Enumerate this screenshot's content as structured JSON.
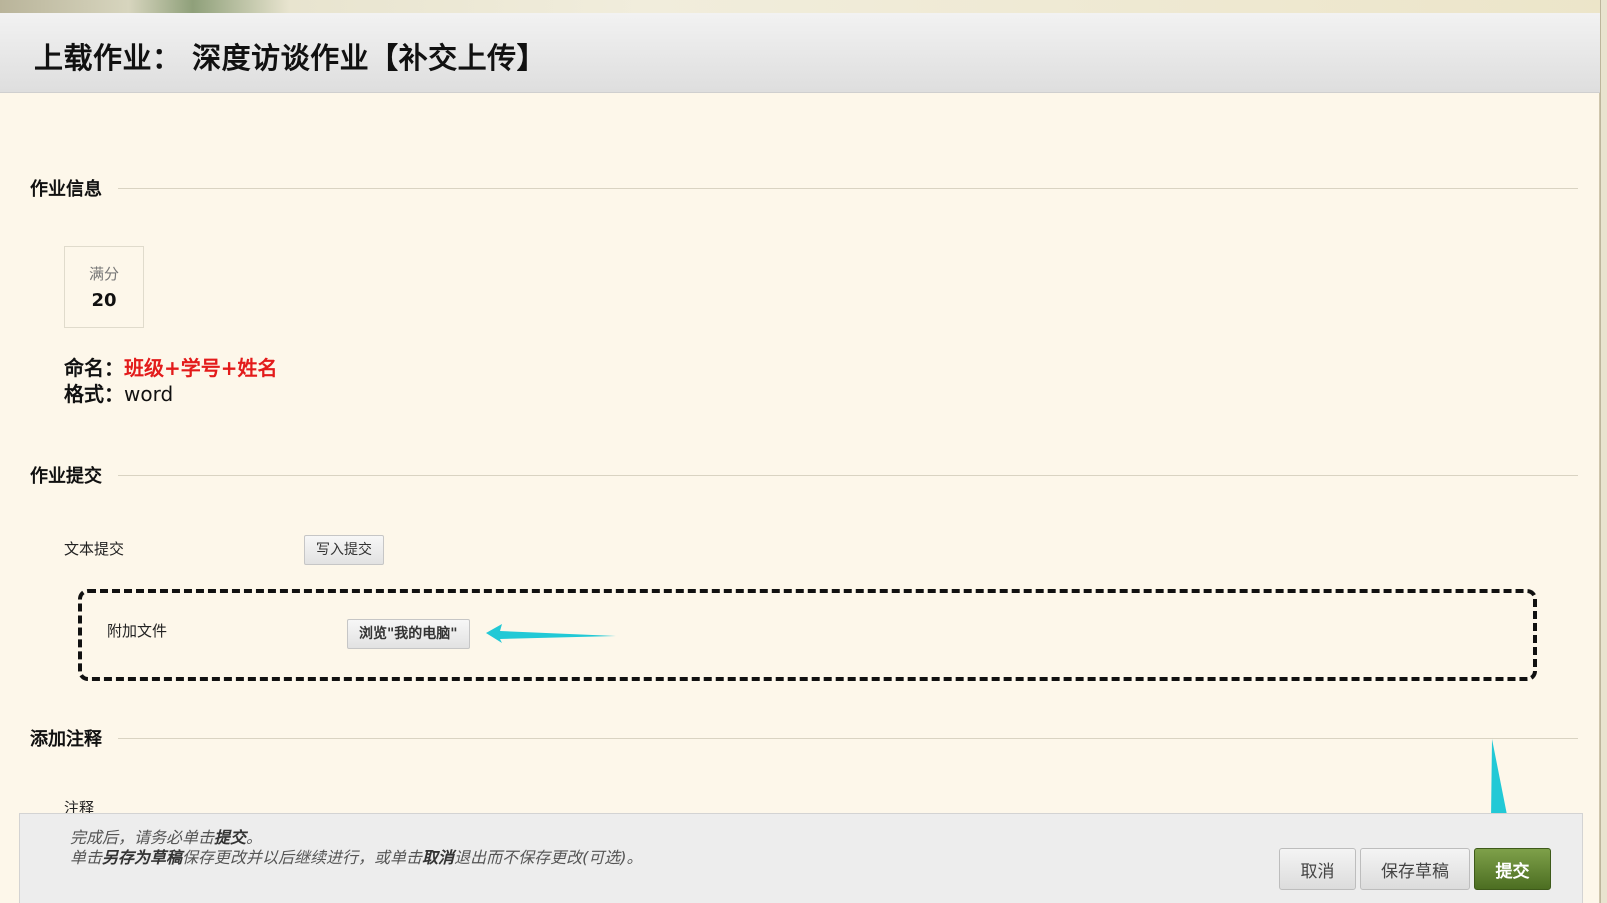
{
  "title": "上载作业： 深度访谈作业【补交上传】",
  "sections": {
    "info": "作业信息",
    "submission": "作业提交",
    "notes": "添加注释"
  },
  "score": {
    "label": "满分",
    "value": "20"
  },
  "instructions": {
    "naming_key": "命名：",
    "naming_value": "班级+学号+姓名",
    "format_key": "格式：",
    "format_value": "word"
  },
  "submission": {
    "text_label": "文本提交",
    "text_button": "写入提交",
    "file_label": "附加文件",
    "file_button": "浏览\"我的电脑\""
  },
  "notes": {
    "comment_label": "注释"
  },
  "footer": {
    "hint_line1_pre": "完成后，请务必单击",
    "hint_line1_bold": "提交",
    "hint_line1_post": "。",
    "hint_line2_pre": "单击",
    "hint_line2_bold1": "另存为草稿",
    "hint_line2_mid": "保存更改并以后继续进行，或单击",
    "hint_line2_bold2": "取消",
    "hint_line2_post": "退出而不保存更改(可选)。",
    "cancel": "取消",
    "save_draft": "保存草稿",
    "submit": "提交"
  },
  "colors": {
    "accent_arrow": "#22c9d6",
    "required_text": "#e31b1b",
    "submit_button": "#5a7d2c"
  }
}
